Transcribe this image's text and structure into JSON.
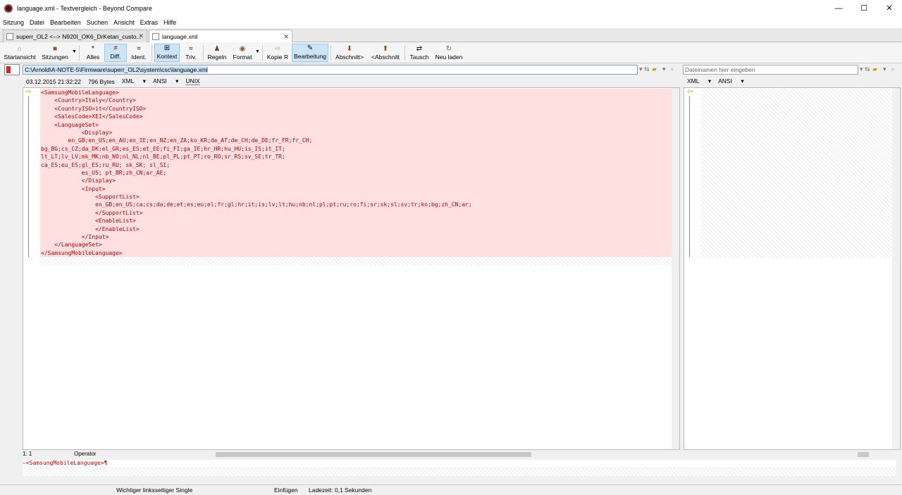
{
  "window": {
    "title": "language.xml - Textvergleich - Beyond Compare",
    "controls": [
      "—",
      "☐",
      "✕"
    ]
  },
  "menu": [
    "Sitzung",
    "Datei",
    "Bearbeiten",
    "Suchen",
    "Ansicht",
    "Extras",
    "Hilfe"
  ],
  "tabs": [
    {
      "label": "superr_OL2 <--> N920I_OK6_DrKetan_custo...",
      "active": false
    },
    {
      "label": "language.xml",
      "active": true
    }
  ],
  "toolbar": {
    "startansicht": "Startansicht",
    "sitzungen": "Sitzungen",
    "alles": "Alles",
    "diff": "Diff.",
    "ident": "Ident.",
    "kontext": "Kontext",
    "triv": "Triv.",
    "regeln": "Regeln",
    "format": "Format",
    "kopie_r": "Kopie R",
    "bearbeitung": "Bearbeitung",
    "abschnitt_next": "Abschnitt>",
    "abschnitt_prev": "<Abschnitt",
    "tausch": "Tausch",
    "neu_laden": "Neu laden"
  },
  "left_pane": {
    "path": "C:\\Arnold\\A-NOTE-5\\Firmware\\superr_OL2\\system\\csc\\language.xml",
    "date": "03.12.2015 21:32:22",
    "size": "796 Bytes",
    "format": "XML",
    "encoding": "ANSI",
    "line_endings": "UNIX",
    "lines": [
      "<SamsungMobileLanguage>",
      "    <Country>Italy</Country>",
      "    <CountryISO>it</CountryISO>",
      "    <SalesCode>XEI</SalesCode>",
      "    <LanguageSet>",
      "            <Display>",
      "        en_GB;en_US;en_AU;en_IE;en_NZ;en_ZA;ko_KR;de_AT;de_CH;de_DE;fr_FR;fr_CH;",
      "bg_BG;cs_CZ;da_DK;el_GR;es_ES;et_EE;fi_FI;ga_IE;hr_HR;hu_HU;is_IS;it_IT;",
      "lt_LT;lv_LV;mk_MK;nb_NO;nl_NL;nl_BE;pl_PL;pt_PT;ro_RO;sr_RS;sv_SE;tr_TR;",
      "ca_ES;eu_ES;gl_ES;ru_RU; sk_SK; sl_SI;",
      "            es_US; pt_BR;zh_CN;ar_AE;",
      "            </Display>",
      "            <Input>",
      "                <SupportList>",
      "                en_GB;en_US;ca;cs;da;de;et;es;eu;el;fr;gl;hr;it;is;lv;lt;hu;nb;nl;pl;pt;ru;ro;fi;sr;sk;sl;sv;tr;ko;bg;zh_CN;ar;",
      "                </SupportList>",
      "                <EnableList>",
      "                </EnableList>",
      "            </Input>",
      "    </LanguageSet>",
      "</SamsungMobileLanguage>"
    ]
  },
  "right_pane": {
    "path_placeholder": "Dateinamen hier eingeben",
    "format": "XML",
    "encoding": "ANSI"
  },
  "position": {
    "cursor": "1: 1",
    "mode": "Operator"
  },
  "current_line": "<SamsungMobileLanguage>¶",
  "statusbar": {
    "message": "Wichtiger linksseitiger Single",
    "insert_mode": "Einfügen",
    "load_time": "Ladezeit: 0,1 Sekunden"
  }
}
